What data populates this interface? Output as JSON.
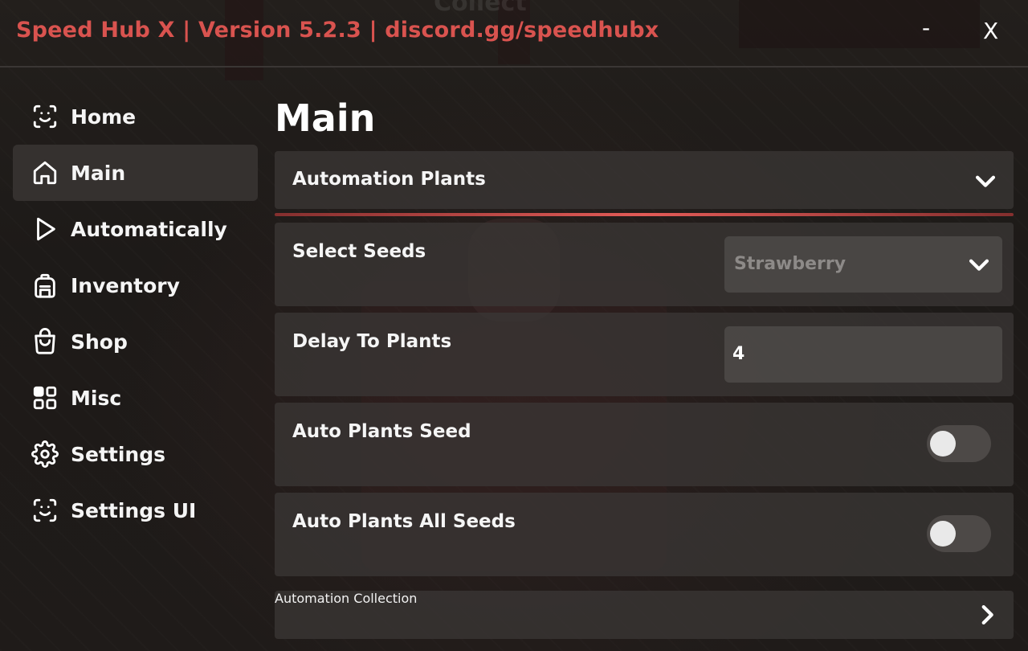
{
  "window": {
    "title": "Speed Hub X | Version 5.2.3 | discord.gg/speedhubx",
    "minimize_label": "-",
    "close_label": "X",
    "background_text": "Collect"
  },
  "colors": {
    "accent": "#d9534f",
    "active_item_bg": "#35312f",
    "panel_bg": "#3a3634"
  },
  "sidebar": {
    "items": [
      {
        "label": "Home",
        "icon": "face-scan-icon",
        "active": false
      },
      {
        "label": "Main",
        "icon": "home-icon",
        "active": true
      },
      {
        "label": "Automatically",
        "icon": "play-icon",
        "active": false
      },
      {
        "label": "Inventory",
        "icon": "backpack-icon",
        "active": false
      },
      {
        "label": "Shop",
        "icon": "shopping-bag-icon",
        "active": false
      },
      {
        "label": "Misc",
        "icon": "grid-icon",
        "active": false
      },
      {
        "label": "Settings",
        "icon": "gear-icon",
        "active": false
      },
      {
        "label": "Settings UI",
        "icon": "face-scan-icon",
        "active": false
      }
    ]
  },
  "main": {
    "title": "Main",
    "section_open": {
      "label": "Automation Plants",
      "icon": "chevron-down-icon"
    },
    "rows": {
      "select_seeds": {
        "label": "Select Seeds",
        "value": "Strawberry"
      },
      "delay_to_plants": {
        "label": "Delay To Plants",
        "value": "4"
      },
      "auto_plants_seed": {
        "label": "Auto Plants Seed",
        "enabled": false
      },
      "auto_plants_all_seeds": {
        "label": "Auto Plants All Seeds",
        "enabled": false
      }
    },
    "section_closed": {
      "label": "Automation Collection",
      "icon": "chevron-right-icon"
    }
  }
}
